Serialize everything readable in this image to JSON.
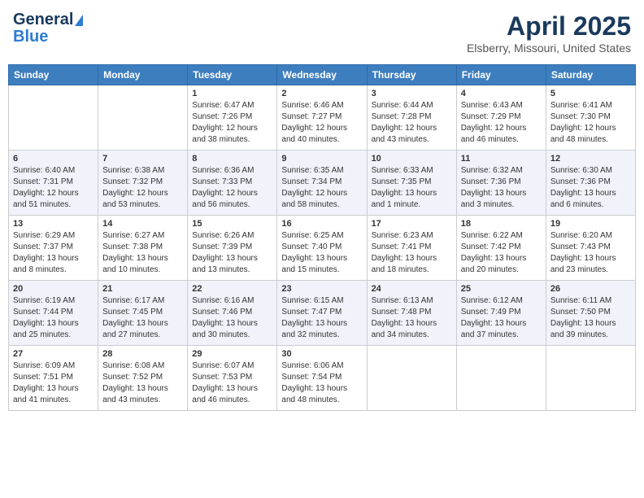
{
  "header": {
    "logo": {
      "general": "General",
      "blue": "Blue"
    },
    "title": "April 2025",
    "location": "Elsberry, Missouri, United States"
  },
  "calendar": {
    "days_of_week": [
      "Sunday",
      "Monday",
      "Tuesday",
      "Wednesday",
      "Thursday",
      "Friday",
      "Saturday"
    ],
    "weeks": [
      [
        {
          "day": "",
          "info": ""
        },
        {
          "day": "",
          "info": ""
        },
        {
          "day": "1",
          "info": "Sunrise: 6:47 AM\nSunset: 7:26 PM\nDaylight: 12 hours\nand 38 minutes."
        },
        {
          "day": "2",
          "info": "Sunrise: 6:46 AM\nSunset: 7:27 PM\nDaylight: 12 hours\nand 40 minutes."
        },
        {
          "day": "3",
          "info": "Sunrise: 6:44 AM\nSunset: 7:28 PM\nDaylight: 12 hours\nand 43 minutes."
        },
        {
          "day": "4",
          "info": "Sunrise: 6:43 AM\nSunset: 7:29 PM\nDaylight: 12 hours\nand 46 minutes."
        },
        {
          "day": "5",
          "info": "Sunrise: 6:41 AM\nSunset: 7:30 PM\nDaylight: 12 hours\nand 48 minutes."
        }
      ],
      [
        {
          "day": "6",
          "info": "Sunrise: 6:40 AM\nSunset: 7:31 PM\nDaylight: 12 hours\nand 51 minutes."
        },
        {
          "day": "7",
          "info": "Sunrise: 6:38 AM\nSunset: 7:32 PM\nDaylight: 12 hours\nand 53 minutes."
        },
        {
          "day": "8",
          "info": "Sunrise: 6:36 AM\nSunset: 7:33 PM\nDaylight: 12 hours\nand 56 minutes."
        },
        {
          "day": "9",
          "info": "Sunrise: 6:35 AM\nSunset: 7:34 PM\nDaylight: 12 hours\nand 58 minutes."
        },
        {
          "day": "10",
          "info": "Sunrise: 6:33 AM\nSunset: 7:35 PM\nDaylight: 13 hours\nand 1 minute."
        },
        {
          "day": "11",
          "info": "Sunrise: 6:32 AM\nSunset: 7:36 PM\nDaylight: 13 hours\nand 3 minutes."
        },
        {
          "day": "12",
          "info": "Sunrise: 6:30 AM\nSunset: 7:36 PM\nDaylight: 13 hours\nand 6 minutes."
        }
      ],
      [
        {
          "day": "13",
          "info": "Sunrise: 6:29 AM\nSunset: 7:37 PM\nDaylight: 13 hours\nand 8 minutes."
        },
        {
          "day": "14",
          "info": "Sunrise: 6:27 AM\nSunset: 7:38 PM\nDaylight: 13 hours\nand 10 minutes."
        },
        {
          "day": "15",
          "info": "Sunrise: 6:26 AM\nSunset: 7:39 PM\nDaylight: 13 hours\nand 13 minutes."
        },
        {
          "day": "16",
          "info": "Sunrise: 6:25 AM\nSunset: 7:40 PM\nDaylight: 13 hours\nand 15 minutes."
        },
        {
          "day": "17",
          "info": "Sunrise: 6:23 AM\nSunset: 7:41 PM\nDaylight: 13 hours\nand 18 minutes."
        },
        {
          "day": "18",
          "info": "Sunrise: 6:22 AM\nSunset: 7:42 PM\nDaylight: 13 hours\nand 20 minutes."
        },
        {
          "day": "19",
          "info": "Sunrise: 6:20 AM\nSunset: 7:43 PM\nDaylight: 13 hours\nand 23 minutes."
        }
      ],
      [
        {
          "day": "20",
          "info": "Sunrise: 6:19 AM\nSunset: 7:44 PM\nDaylight: 13 hours\nand 25 minutes."
        },
        {
          "day": "21",
          "info": "Sunrise: 6:17 AM\nSunset: 7:45 PM\nDaylight: 13 hours\nand 27 minutes."
        },
        {
          "day": "22",
          "info": "Sunrise: 6:16 AM\nSunset: 7:46 PM\nDaylight: 13 hours\nand 30 minutes."
        },
        {
          "day": "23",
          "info": "Sunrise: 6:15 AM\nSunset: 7:47 PM\nDaylight: 13 hours\nand 32 minutes."
        },
        {
          "day": "24",
          "info": "Sunrise: 6:13 AM\nSunset: 7:48 PM\nDaylight: 13 hours\nand 34 minutes."
        },
        {
          "day": "25",
          "info": "Sunrise: 6:12 AM\nSunset: 7:49 PM\nDaylight: 13 hours\nand 37 minutes."
        },
        {
          "day": "26",
          "info": "Sunrise: 6:11 AM\nSunset: 7:50 PM\nDaylight: 13 hours\nand 39 minutes."
        }
      ],
      [
        {
          "day": "27",
          "info": "Sunrise: 6:09 AM\nSunset: 7:51 PM\nDaylight: 13 hours\nand 41 minutes."
        },
        {
          "day": "28",
          "info": "Sunrise: 6:08 AM\nSunset: 7:52 PM\nDaylight: 13 hours\nand 43 minutes."
        },
        {
          "day": "29",
          "info": "Sunrise: 6:07 AM\nSunset: 7:53 PM\nDaylight: 13 hours\nand 46 minutes."
        },
        {
          "day": "30",
          "info": "Sunrise: 6:06 AM\nSunset: 7:54 PM\nDaylight: 13 hours\nand 48 minutes."
        },
        {
          "day": "",
          "info": ""
        },
        {
          "day": "",
          "info": ""
        },
        {
          "day": "",
          "info": ""
        }
      ]
    ]
  }
}
